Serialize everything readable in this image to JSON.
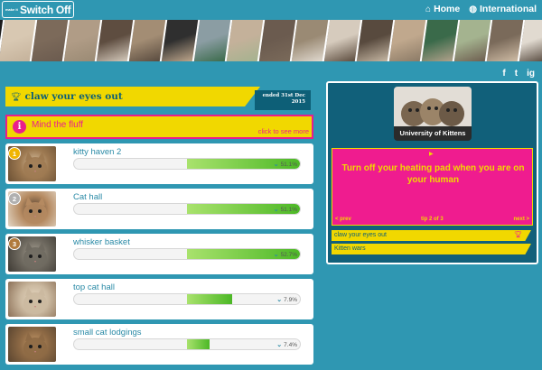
{
  "header": {
    "logo_small": "make it",
    "logo_main": "Switch Off",
    "nav": [
      {
        "label": "Home",
        "icon": "home-icon"
      },
      {
        "label": "International",
        "icon": "globe-icon"
      }
    ]
  },
  "photo_strip": {
    "colors": [
      "#d8c8b2",
      "#7c6a5a",
      "#b09c86",
      "#5e4d40",
      "#a38d74",
      "#2f2f2f",
      "#8b9da3",
      "#c4b19a",
      "#6b5b4f",
      "#9a8a74",
      "#d6cbbd",
      "#584a3e",
      "#c0a88d",
      "#3a6a4a",
      "#a4b38f",
      "#7a6a5a",
      "#e1dad0",
      "#5a4a3c",
      "#c7b8a4",
      "#8b7a66",
      "#b3a28c",
      "#6d5d4f",
      "#d0bda6",
      "#4c3f34",
      "#9b8d7c",
      "#c6b6a1",
      "#7f6d5b",
      "#e2d6c4",
      "#5c5044",
      "#a99a86",
      "#897664",
      "#cdbba4",
      "#6a5848",
      "#bfae98",
      "#3d3530",
      "#a8947e"
    ]
  },
  "social": [
    {
      "icon": "facebook-icon",
      "label": "f"
    },
    {
      "icon": "twitter-icon",
      "label": "t"
    },
    {
      "icon": "instagram-icon",
      "label": "ig"
    }
  ],
  "competition": {
    "title": "claw your eyes out",
    "ended": "ended 31st Dec\n2015",
    "notice_title": "Mind the fluff",
    "notice_link": "click to see more"
  },
  "entries": [
    {
      "rank": "1",
      "name": "kitty haven 2",
      "percent": "51.1%",
      "fill": 0.51,
      "rank_color": "#f0b400",
      "thumb": [
        "#9e7a52",
        "#d9c2a2",
        "#6b5034"
      ]
    },
    {
      "rank": "2",
      "name": "Cat hall",
      "percent": "51.1%",
      "fill": 0.51,
      "rank_color": "#b0b0b0",
      "thumb": [
        "#b58a61",
        "#4b3a2b",
        "#e3d6c5"
      ]
    },
    {
      "rank": "3",
      "name": "whisker basket",
      "percent": "52.7%",
      "fill": 0.527,
      "rank_color": "#b07a3c",
      "thumb": [
        "#6f6a60",
        "#a9a295",
        "#3e3a34"
      ]
    },
    {
      "rank": "",
      "name": "top cat hall",
      "percent": "7.9%",
      "fill": 0.7,
      "rank_color": "",
      "thumb": [
        "#cbb9a0",
        "#e7d9c3",
        "#8c7158"
      ]
    },
    {
      "rank": "",
      "name": "small cat lodgings",
      "percent": "7.4%",
      "fill": 0.6,
      "rank_color": "",
      "thumb": [
        "#8e6a45",
        "#c69a6a",
        "#5a4530"
      ]
    }
  ],
  "panel": {
    "university": "University of Kittens",
    "tip_text": "Turn off your heating pad when you are on your human",
    "prev": "< prev",
    "next": "next >",
    "tip_count": "tip 2 of 3",
    "tags": [
      {
        "label": "claw your eyes out",
        "trophy": true
      },
      {
        "label": "Kitten wars",
        "trophy": false
      }
    ]
  },
  "colors": {
    "background": "#2f97b2",
    "yellow": "#f1d800",
    "pink": "#e91e8c",
    "dark_teal": "#0d5f77",
    "green": "#4cb826"
  }
}
